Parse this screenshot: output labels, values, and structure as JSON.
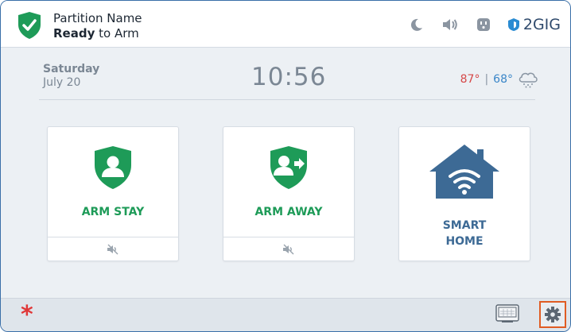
{
  "header": {
    "partition_name": "Partition Name",
    "status_bold": "Ready",
    "status_rest": " to Arm",
    "brand": "2GIG",
    "icons": [
      "moon-icon",
      "speaker-icon",
      "outlet-icon",
      "brand-logo-icon"
    ]
  },
  "info": {
    "day": "Saturday",
    "date": "July 20",
    "time": "10:56",
    "temp_high": "87°",
    "temp_sep": "|",
    "temp_low": "68°",
    "weather_icon": "snow-cloud-icon"
  },
  "cards": {
    "arm_stay": {
      "label": "ARM STAY",
      "icon": "shield-person-icon",
      "sub_icon": "speaker-muted-icon"
    },
    "arm_away": {
      "label": "ARM AWAY",
      "icon": "shield-person-arrow-icon",
      "sub_icon": "speaker-muted-icon"
    },
    "smart_home": {
      "label_line1": "SMART",
      "label_line2": "HOME",
      "icon": "house-wifi-icon"
    }
  },
  "footer": {
    "emergency_glyph": "*",
    "icons": [
      "emergency-icon",
      "keypad-icon",
      "gear-icon"
    ]
  },
  "colors": {
    "green": "#1e9b58",
    "blue": "#3d6a95",
    "red": "#e03838",
    "highlight": "#e05c23"
  }
}
